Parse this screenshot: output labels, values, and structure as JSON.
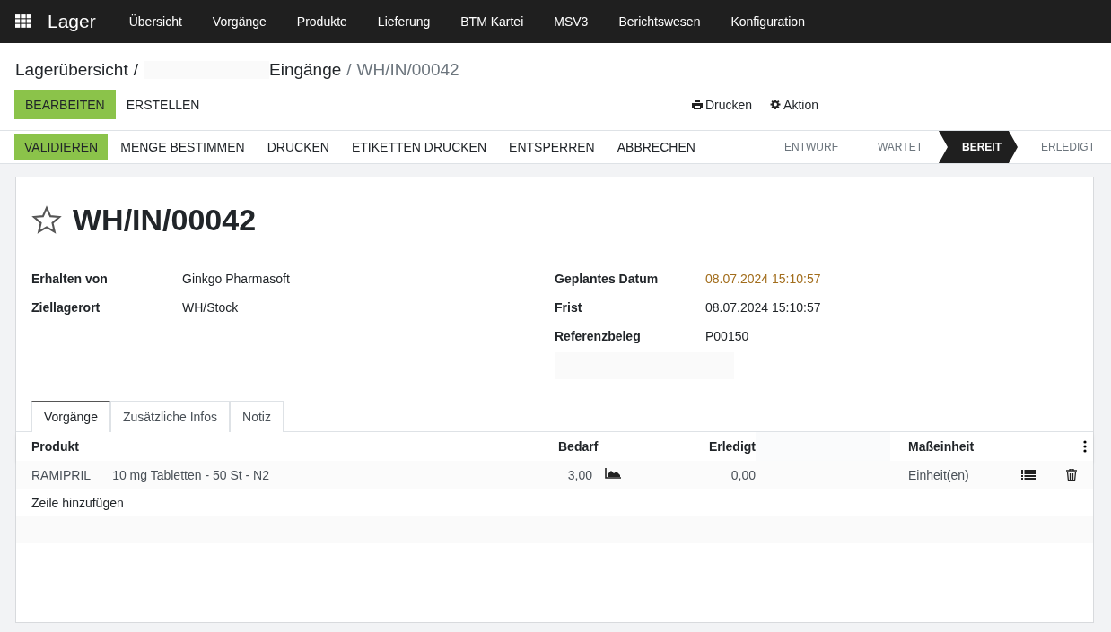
{
  "app": {
    "name": "Lager",
    "menu": [
      "Übersicht",
      "Vorgänge",
      "Produkte",
      "Lieferung",
      "BTM Kartei",
      "MSV3",
      "Berichtswesen",
      "Konfiguration"
    ]
  },
  "breadcrumb": [
    {
      "label": "Lagerübersicht",
      "current": false
    },
    {
      "separator": "/",
      "label": "Eingänge",
      "current": false
    },
    {
      "separator": "/",
      "label": "WH/IN/00042",
      "current": true
    }
  ],
  "control_buttons": [
    {
      "label": "BEARBEITEN",
      "primary": true
    },
    {
      "label": "ERSTELLEN",
      "primary": false
    }
  ],
  "side_actions": [
    {
      "label": "Drucken",
      "kind": "print"
    },
    {
      "label": "Aktion",
      "kind": "gear"
    }
  ],
  "status_actions": [
    {
      "label": "VALIDIEREN",
      "primary": true
    },
    {
      "label": "MENGE BESTIMMEN",
      "primary": false
    },
    {
      "label": "DRUCKEN",
      "primary": false
    },
    {
      "label": "ETIKETTEN DRUCKEN",
      "primary": false
    },
    {
      "label": "ENTSPERREN",
      "primary": false
    },
    {
      "label": "ABBRECHEN",
      "primary": false
    }
  ],
  "stages": [
    {
      "label": "ENTWURF",
      "selected": false
    },
    {
      "label": "WARTET",
      "selected": false
    },
    {
      "label": "BEREIT",
      "selected": true
    },
    {
      "label": "ERLEDIGT",
      "selected": false
    }
  ],
  "record": {
    "title": "WH/IN/00042",
    "starred": false,
    "left_fields": [
      {
        "label": "Erhalten von",
        "value": "Ginkgo Pharmasoft",
        "warning": false
      },
      {
        "label": "Ziellagerort",
        "value": "WH/Stock",
        "warning": false
      }
    ],
    "right_fields": [
      {
        "label": "Geplantes Datum",
        "value": "08.07.2024 15:10:57",
        "warning": true
      },
      {
        "label": "Frist",
        "value": "08.07.2024 15:10:57",
        "warning": false
      },
      {
        "label": "Referenzbeleg",
        "value": "P00150",
        "warning": false
      }
    ]
  },
  "tabs": [
    {
      "label": "Vorgänge",
      "selected": true
    },
    {
      "label": "Zusätzliche Infos",
      "selected": false
    },
    {
      "label": "Notiz",
      "selected": false
    }
  ],
  "table": {
    "columns": [
      "Produkt",
      "Bedarf",
      "Erledigt",
      "Maßeinheit"
    ],
    "rows": [
      {
        "code": "RAMIPRIL",
        "name": "10 mg Tabletten - 50 St - N2",
        "demand": "3,00",
        "done": "0,00",
        "uom": "Einheit(en)"
      }
    ],
    "add_line": "Zeile hinzufügen"
  }
}
